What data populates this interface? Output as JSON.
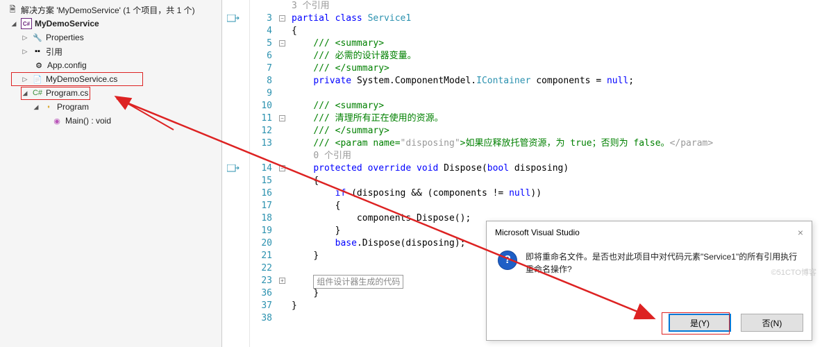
{
  "solution": {
    "title": "解决方案 'MyDemoService' (1 个项目，共 1 个)",
    "project": "MyDemoService",
    "nodes": {
      "properties": "Properties",
      "references": "引用",
      "appconfig": "App.config",
      "servicefile": "MyDemoService.cs",
      "programfile": "Program.cs",
      "programclass": "Program",
      "main": "Main() : void"
    }
  },
  "code": {
    "ref3": "3 个引用",
    "ref0": "0 个引用",
    "line3a": "partial class ",
    "line3b": "Service1",
    "brace_open": "{",
    "brace_close": "}",
    "sum_open": "/// <summary>",
    "sum_close": "/// </summary>",
    "line6": "/// 必需的设计器变量。",
    "line8a": "private ",
    "line8b": "System.ComponentModel.",
    "line8c": "IContainer",
    "line8d": " components = ",
    "line8e": "null",
    "line8f": ";",
    "line11": "/// 清理所有正在使用的资源。",
    "line13a": "/// <param name=",
    "line13b": "\"disposing\"",
    "line13c": ">如果应释放托管资源，为 true；否则为 false。",
    "line13d": "</param>",
    "line14a": "protected override void ",
    "line14b": "Dispose",
    "line14c": "(",
    "line14d": "bool",
    "line14e": " disposing)",
    "line16a": "if",
    "line16b": " (disposing && (components != ",
    "line16c": "null",
    "line16d": "))",
    "line18": "components.Dispose();",
    "line20a": "base",
    "line20b": ".Dispose(disposing);",
    "line23": "组件设计器生成的代码",
    "linenums": [
      "",
      "3",
      "4",
      "5",
      "6",
      "7",
      "8",
      "9",
      "10",
      "11",
      "12",
      "13",
      "",
      "14",
      "15",
      "16",
      "17",
      "18",
      "19",
      "20",
      "21",
      "22",
      "23",
      "36",
      "37",
      "38"
    ]
  },
  "dialog": {
    "title": "Microsoft Visual Studio",
    "message": "即将重命名文件。是否也对此项目中对代码元素\"Service1\"的所有引用执行重命名操作?",
    "yes": "是(Y)",
    "no": "否(N)"
  },
  "watermark": "©51CTO博客"
}
